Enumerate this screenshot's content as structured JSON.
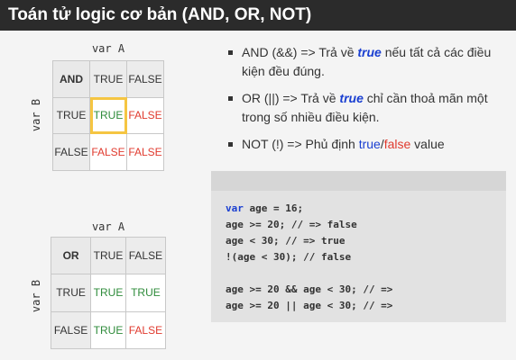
{
  "title": "Toán tử logic cơ bản (AND, OR, NOT)",
  "and_table": {
    "col_var": "var A",
    "row_var": "var B",
    "rows": [
      [
        "AND",
        "TRUE",
        "FALSE"
      ],
      [
        "TRUE",
        "TRUE",
        "FALSE"
      ],
      [
        "FALSE",
        "FALSE",
        "FALSE"
      ]
    ]
  },
  "or_table": {
    "col_var": "var A",
    "row_var": "var B",
    "rows": [
      [
        "OR",
        "TRUE",
        "FALSE"
      ],
      [
        "TRUE",
        "TRUE",
        "TRUE"
      ],
      [
        "FALSE",
        "TRUE",
        "FALSE"
      ]
    ]
  },
  "bullets": {
    "and": {
      "prefix": "AND (&&) => Trả về ",
      "kw": "true",
      "suffix": " nếu tất cả các điều kiện đều đúng."
    },
    "or": {
      "prefix": "OR (||) => Trả về ",
      "kw": "true",
      "suffix": " chỉ cần thoả mãn một trong số nhiều điều kiện."
    },
    "not": {
      "prefix": "NOT (!) => Phủ định ",
      "w_true": "true",
      "sep": "/",
      "w_false": "false",
      "suffix": " value"
    }
  },
  "code": {
    "line1_kw": "var",
    "line1_rest": " age = 16;",
    "line2": "age >= 20; // => false",
    "line3": "age < 30; // => true",
    "line4": "!(age < 30); // false",
    "line5": "",
    "line6": "age >= 20 && age < 30; // =>",
    "line7": "age >= 20 || age < 30; // =>"
  },
  "colors": {
    "true_green": "#2e8b3a",
    "false_red": "#e03a2e",
    "keyword_blue": "#1a3fd1",
    "highlight": "#f5c542"
  }
}
